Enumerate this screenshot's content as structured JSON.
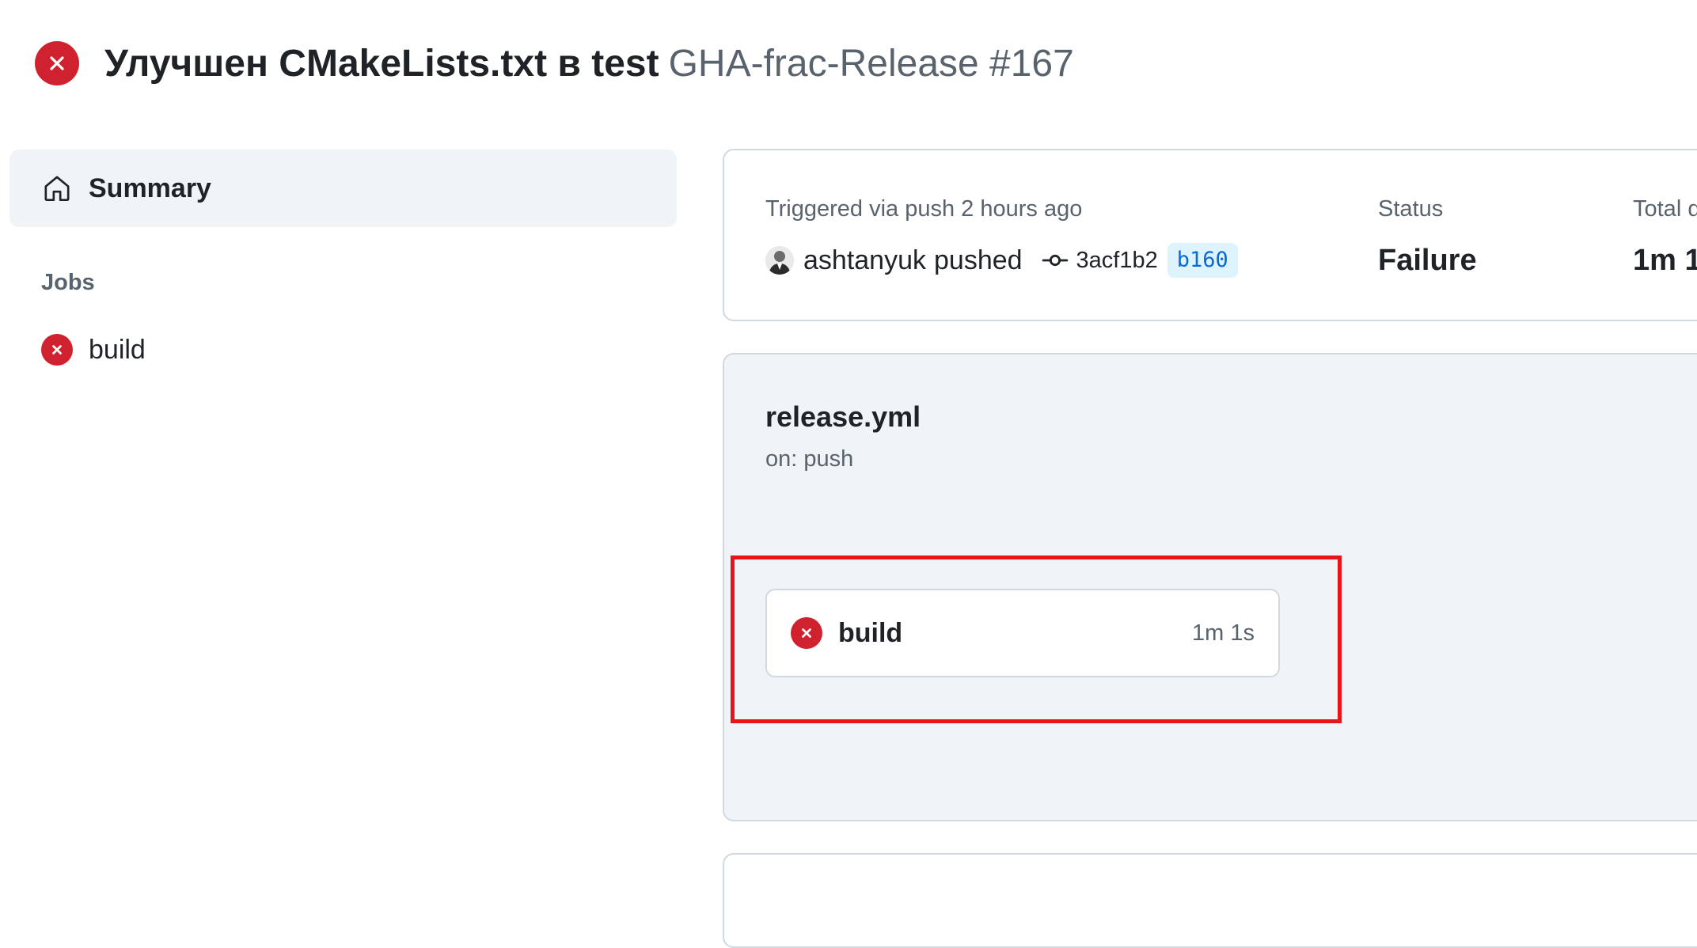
{
  "header": {
    "status_icon": "x-circle-fill-icon",
    "status_color": "#cf222e",
    "commit_title": "Улучшен CMakeLists.txt в test",
    "workflow_run": "GHA-frac-Release #167"
  },
  "sidebar": {
    "summary": {
      "icon": "home-icon",
      "label": "Summary"
    },
    "jobs_heading": "Jobs",
    "jobs": [
      {
        "icon": "x-circle-fill-icon",
        "label": "build"
      }
    ]
  },
  "run_info": {
    "triggered_label": "Triggered via push 2 hours ago",
    "actor": "ashtanyuk",
    "action": "pushed",
    "commit_icon": "git-commit-icon",
    "commit_sha": "3acf1b2",
    "branch": "b160",
    "status_label": "Status",
    "status_value": "Failure",
    "duration_label": "Total d",
    "duration_value": "1m 1"
  },
  "workflow": {
    "file": "release.yml",
    "trigger": "on: push",
    "jobs": [
      {
        "icon": "x-circle-fill-icon",
        "name": "build",
        "duration": "1m 1s"
      }
    ]
  },
  "colors": {
    "failure": "#cf222e",
    "branch_bg": "#ddf4ff",
    "branch_text": "#0969da",
    "highlight": "#e8141b",
    "panel_bg": "#f1f4f7",
    "border": "#d1d9e0",
    "muted_text": "#59636e"
  }
}
